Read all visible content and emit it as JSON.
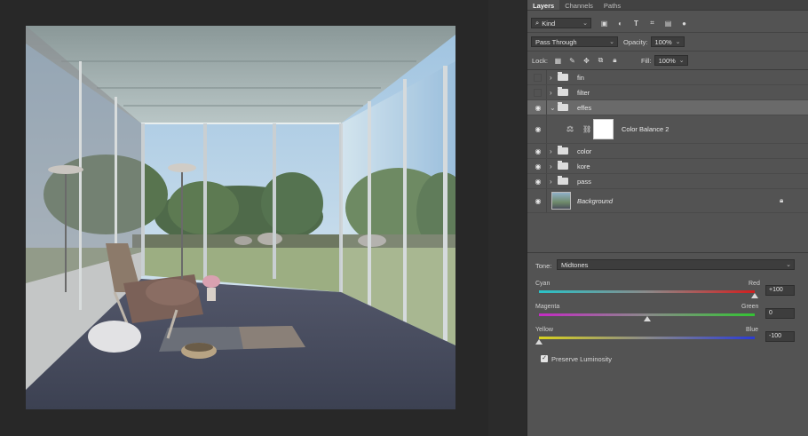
{
  "layers_panel": {
    "tabs": [
      "Layers",
      "Channels",
      "Paths"
    ],
    "active_tab": "Layers",
    "filter": {
      "label": "Kind",
      "icons": [
        "image-filter-icon",
        "adjustment-filter-icon",
        "type-filter-icon",
        "shape-filter-icon",
        "smart-object-filter-icon",
        "filter-toggle-icon"
      ]
    },
    "blend_mode": "Pass Through",
    "opacity_label": "Opacity:",
    "opacity_value": "100%",
    "lock_label": "Lock:",
    "fill_label": "Fill:",
    "fill_value": "100%",
    "layers": [
      {
        "name": "fin",
        "type": "group",
        "visible": false
      },
      {
        "name": "filter",
        "type": "group",
        "visible": false
      },
      {
        "name": "effes",
        "type": "group",
        "visible": true,
        "expanded": true,
        "selected": true
      },
      {
        "name": "Color Balance 2",
        "type": "adjustment",
        "visible": true
      },
      {
        "name": "color",
        "type": "group",
        "visible": true
      },
      {
        "name": "kore",
        "type": "group",
        "visible": true
      },
      {
        "name": "pass",
        "type": "group",
        "visible": true
      },
      {
        "name": "Background",
        "type": "image",
        "visible": true,
        "locked": true
      }
    ]
  },
  "properties": {
    "tone_label": "Tone:",
    "tone_value": "Midtones",
    "sliders": [
      {
        "left": "Cyan",
        "right": "Red",
        "value": "+100",
        "position": 1.0
      },
      {
        "left": "Magenta",
        "right": "Green",
        "value": "0",
        "position": 0.5
      },
      {
        "left": "Yellow",
        "right": "Blue",
        "value": "-100",
        "position": 0.0
      }
    ],
    "preserve_luminosity_label": "Preserve Luminosity",
    "preserve_luminosity": true
  }
}
